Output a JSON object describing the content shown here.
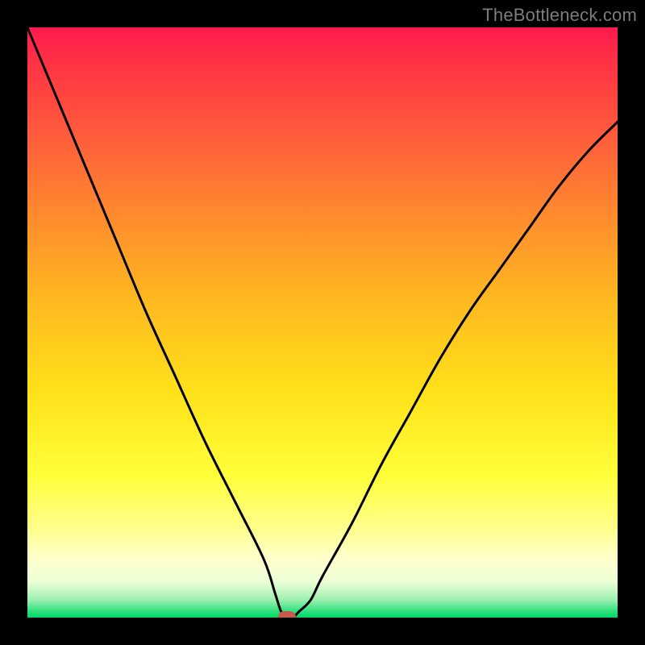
{
  "watermark": "TheBottleneck.com",
  "chart_data": {
    "type": "line",
    "title": "",
    "xlabel": "",
    "ylabel": "",
    "xlim": [
      0,
      100
    ],
    "ylim": [
      0,
      100
    ],
    "grid": false,
    "legend": false,
    "series": [
      {
        "name": "bottleneck-curve",
        "x": [
          0,
          5,
          10,
          15,
          20,
          25,
          30,
          35,
          40,
          42,
          43,
          44,
          45,
          46,
          48,
          50,
          55,
          60,
          65,
          70,
          75,
          80,
          85,
          90,
          95,
          100
        ],
        "y": [
          100,
          88,
          76,
          64,
          52,
          41,
          30,
          20,
          10,
          4,
          1,
          0,
          0,
          1,
          3,
          7,
          16,
          26,
          35,
          44,
          52,
          59,
          66,
          73,
          79,
          84
        ]
      }
    ],
    "marker": {
      "x": 44,
      "y": 0,
      "color": "#c75a4d"
    },
    "background_gradient": {
      "stops": [
        {
          "pos": 0,
          "color": "#ff1a4d"
        },
        {
          "pos": 50,
          "color": "#ffcc20"
        },
        {
          "pos": 88,
          "color": "#ffff8e"
        },
        {
          "pos": 100,
          "color": "#00d86a"
        }
      ]
    }
  }
}
